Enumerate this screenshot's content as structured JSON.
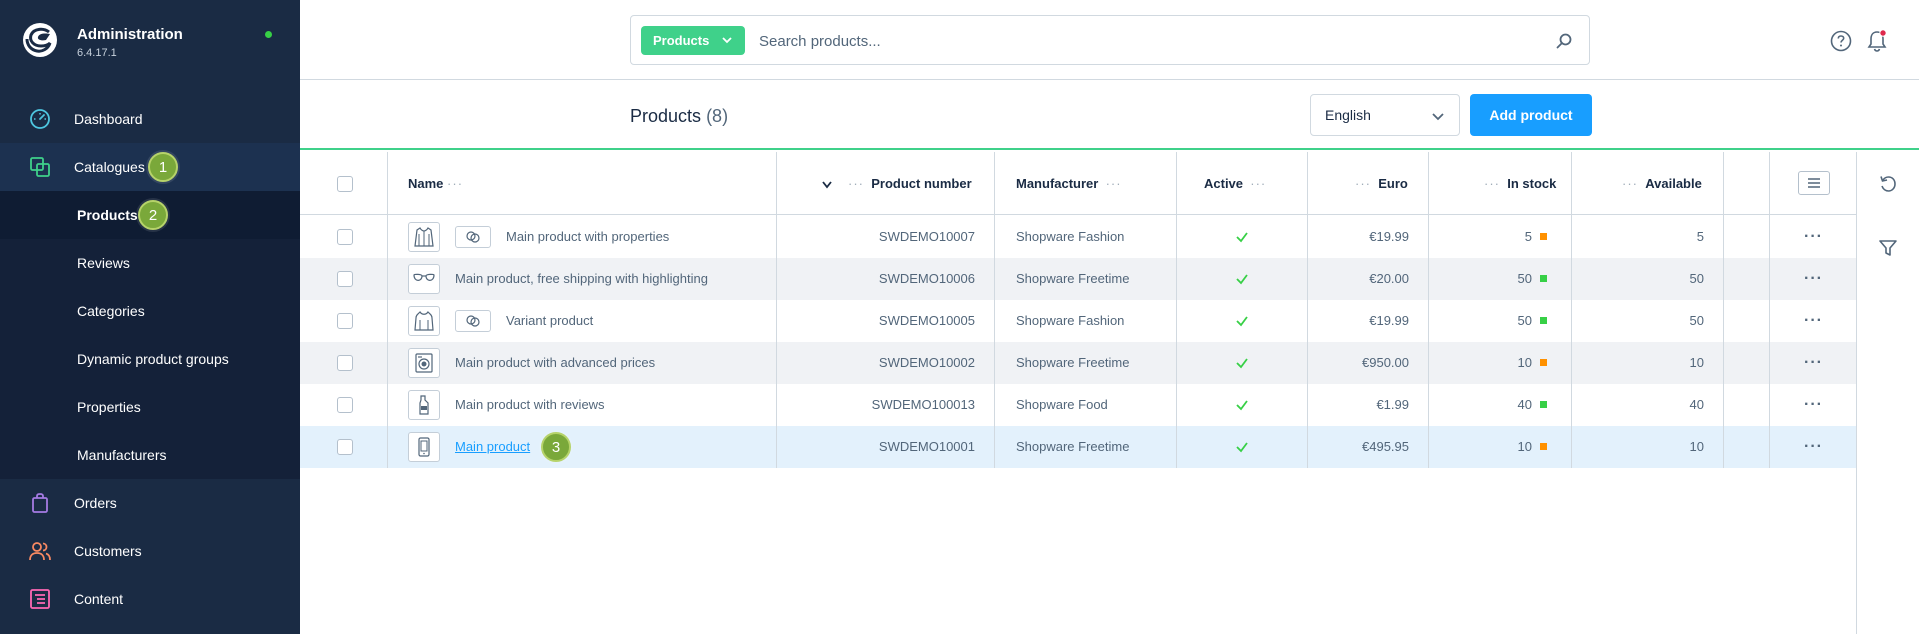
{
  "app": {
    "title": "Administration",
    "version": "6.4.17.1",
    "status_color": "#37d046"
  },
  "sidebar": {
    "items": [
      {
        "label": "Dashboard",
        "icon": "dashboard-gauge-icon"
      },
      {
        "label": "Catalogues",
        "icon": "catalogues-icon",
        "badge": "1"
      },
      {
        "label": "Products",
        "badge": "2"
      },
      {
        "label": "Reviews"
      },
      {
        "label": "Categories"
      },
      {
        "label": "Dynamic product groups"
      },
      {
        "label": "Properties"
      },
      {
        "label": "Manufacturers"
      },
      {
        "label": "Orders",
        "icon": "orders-bag-icon"
      },
      {
        "label": "Customers",
        "icon": "customers-icon"
      },
      {
        "label": "Content",
        "icon": "content-icon"
      }
    ]
  },
  "search": {
    "type_label": "Products",
    "placeholder": "Search products..."
  },
  "header": {
    "title": "Products",
    "count": "(8)",
    "language": "English",
    "add_button": "Add product"
  },
  "table": {
    "columns": {
      "name": "Name",
      "product_number": "Product number",
      "manufacturer": "Manufacturer",
      "active": "Active",
      "euro": "Euro",
      "in_stock": "In stock",
      "available": "Available"
    },
    "rows": [
      {
        "name": "Main product with properties",
        "number": "SWDEMO10007",
        "manufacturer": "Shopware Fashion",
        "price": "€19.99",
        "stock": "5",
        "stock_status": "#ff9100",
        "available": "5",
        "thumb": "jacket-icon",
        "variant": true
      },
      {
        "name": "Main product, free shipping with highlighting",
        "number": "SWDEMO10006",
        "manufacturer": "Shopware Freetime",
        "price": "€20.00",
        "stock": "50",
        "stock_status": "#37d046",
        "available": "50",
        "thumb": "sunglasses-icon",
        "variant": false
      },
      {
        "name": "Variant product",
        "number": "SWDEMO10005",
        "manufacturer": "Shopware Fashion",
        "price": "€19.99",
        "stock": "50",
        "stock_status": "#37d046",
        "available": "50",
        "thumb": "hoodie-icon",
        "variant": true
      },
      {
        "name": "Main product with advanced prices",
        "number": "SWDEMO10002",
        "manufacturer": "Shopware Freetime",
        "price": "€950.00",
        "stock": "10",
        "stock_status": "#ff9100",
        "available": "10",
        "thumb": "washing-machine-icon",
        "variant": false
      },
      {
        "name": "Main product with reviews",
        "number": "SWDEMO100013",
        "manufacturer": "Shopware Food",
        "price": "€1.99",
        "stock": "40",
        "stock_status": "#37d046",
        "available": "40",
        "thumb": "bottle-icon",
        "variant": false
      },
      {
        "name": "Main product",
        "number": "SWDEMO10001",
        "manufacturer": "Shopware Freetime",
        "price": "€495.95",
        "stock": "10",
        "stock_status": "#ff9100",
        "available": "10",
        "thumb": "smartphone-icon",
        "variant": false,
        "badge": "3"
      }
    ]
  },
  "colors": {
    "sidebar_bg": "#1a2b44",
    "accent_green": "#3fd18a",
    "primary_blue": "#189eff",
    "badge_green": "#7aa83a"
  }
}
